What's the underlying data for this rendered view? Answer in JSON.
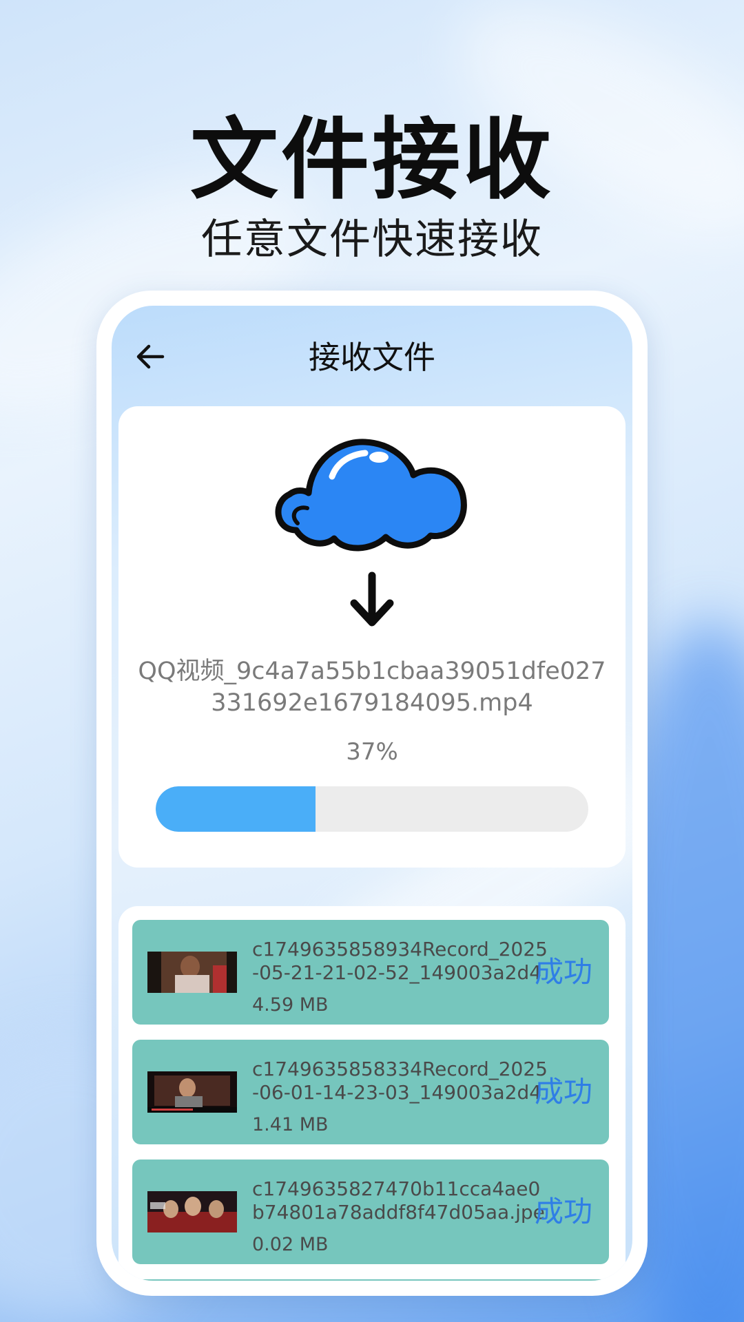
{
  "hero": {
    "title": "文件接收",
    "subtitle": "任意文件快速接收"
  },
  "topbar": {
    "back_icon": "arrow-left-icon",
    "title": "接收文件"
  },
  "receive": {
    "cloud_icon": "cloud-icon",
    "arrow_icon": "arrow-down-icon",
    "filename": "QQ视频_9c4a7a55b1cbaa39051dfe027331692e1679184095.mp4",
    "percent_label": "37%",
    "progress": 0.37
  },
  "colors": {
    "progress_fill": "#4aaef8",
    "progress_track": "#ececec",
    "item_bg": "#76c6bd",
    "status_text": "#2f7ee6",
    "cloud_fill": "#2b86f4"
  },
  "files": [
    {
      "name": "c1749635858934Record_2025-05-21-21-02-52_149003a2d400",
      "size": "4.59 MB",
      "status": "成功"
    },
    {
      "name": "c1749635858334Record_2025-06-01-14-23-03_149003a2d400",
      "size": "1.41 MB",
      "status": "成功"
    },
    {
      "name": "c1749635827470b11cca4ae0b74801a78addf8f47d05aa.jpeg",
      "size": "0.02 MB",
      "status": "成功"
    }
  ]
}
